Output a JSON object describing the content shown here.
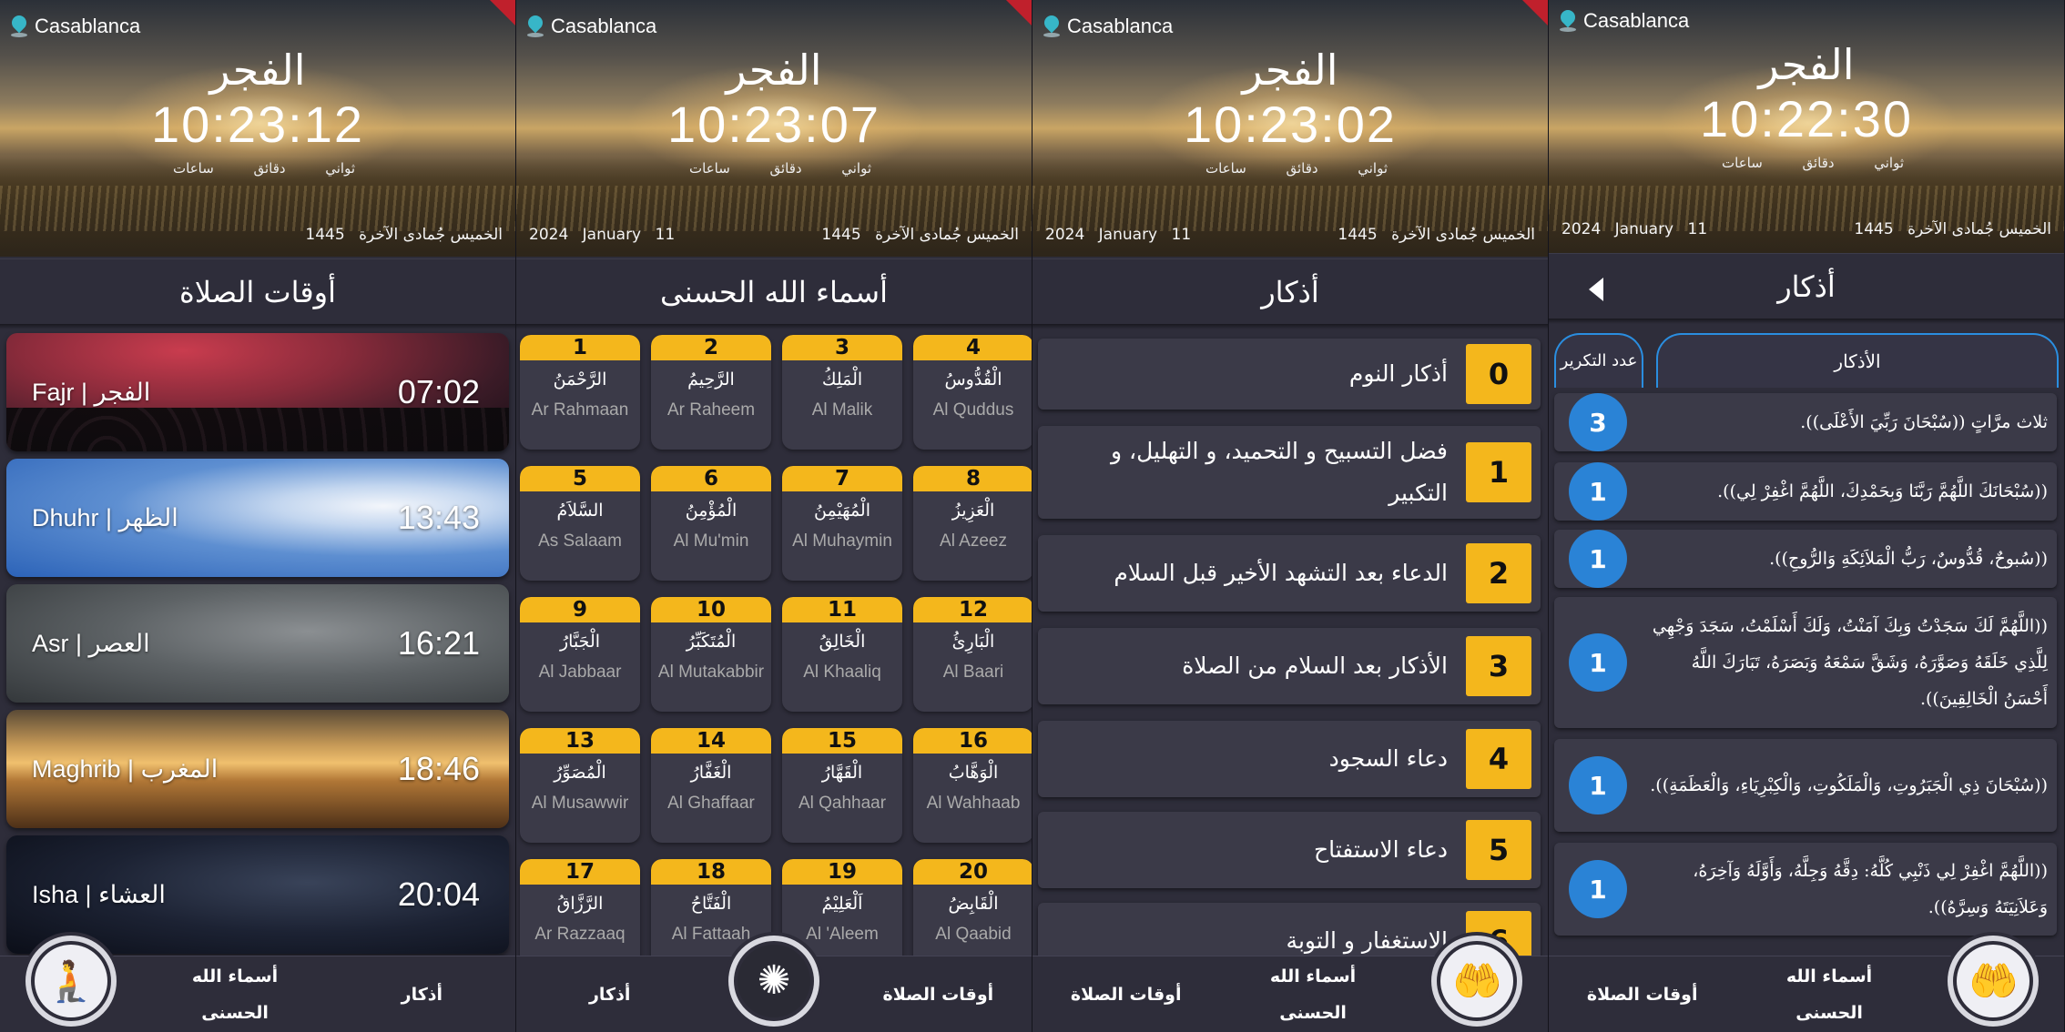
{
  "header": {
    "location": "Casablanca",
    "prayer_name": "الفجر",
    "units": {
      "seconds": "ثواني",
      "minutes": "دقائق",
      "hours": "ساعات"
    },
    "hijri": {
      "weekday": "الخميس",
      "month": "جُمادى الآخرة",
      "year": "1445"
    },
    "gregorian": {
      "day": "11",
      "month": "January",
      "year": "2024"
    },
    "clocks": [
      "10:23:12",
      "10:23:07",
      "10:23:02",
      "10:22:30"
    ]
  },
  "titles": {
    "prayer_times": "أوقات الصلاة",
    "names": "أسماء الله الحسنى",
    "adhkar": "أذكار"
  },
  "prayer_times": [
    {
      "name": "Fajr  |  الفجر",
      "time": "07:02"
    },
    {
      "name": "Dhuhr  |  الظهر",
      "time": "13:43"
    },
    {
      "name": "Asr  |  العصر",
      "time": "16:21"
    },
    {
      "name": "Maghrib  |  المغرب",
      "time": "18:46"
    },
    {
      "name": "Isha  |  العشاء",
      "time": "20:04"
    }
  ],
  "names": [
    {
      "n": "1",
      "ar": "الرَّحْمَنُ",
      "en": "Ar Rahmaan"
    },
    {
      "n": "2",
      "ar": "الرَّحِيمُ",
      "en": "Ar Raheem"
    },
    {
      "n": "3",
      "ar": "الْمَلِكُ",
      "en": "Al Malik"
    },
    {
      "n": "4",
      "ar": "الْقُدُّوسُ",
      "en": "Al Quddus"
    },
    {
      "n": "5",
      "ar": "السَّلاَمُ",
      "en": "As Salaam"
    },
    {
      "n": "6",
      "ar": "الْمُؤْمِنُ",
      "en": "Al Mu'min"
    },
    {
      "n": "7",
      "ar": "الْمُهَيْمِنُ",
      "en": "Al Muhaymin"
    },
    {
      "n": "8",
      "ar": "الْعَزِيزُ",
      "en": "Al Azeez"
    },
    {
      "n": "9",
      "ar": "الْجَبَّارُ",
      "en": "Al Jabbaar"
    },
    {
      "n": "10",
      "ar": "الْمُتَكَبِّرُ",
      "en": "Al Mutakabbir"
    },
    {
      "n": "11",
      "ar": "الْخَالِقُ",
      "en": "Al Khaaliq"
    },
    {
      "n": "12",
      "ar": "الْبَارِئُ",
      "en": "Al Baari"
    },
    {
      "n": "13",
      "ar": "الْمُصَوِّرُ",
      "en": "Al Musawwir"
    },
    {
      "n": "14",
      "ar": "الْغَفَّارُ",
      "en": "Al Ghaffaar"
    },
    {
      "n": "15",
      "ar": "الْقَهَّارُ",
      "en": "Al Qahhaar"
    },
    {
      "n": "16",
      "ar": "الْوَهَّابُ",
      "en": "Al Wahhaab"
    },
    {
      "n": "17",
      "ar": "الرَّزَّاقُ",
      "en": "Ar Razzaaq"
    },
    {
      "n": "18",
      "ar": "الْفَتَّاحُ",
      "en": "Al Fattaah"
    },
    {
      "n": "19",
      "ar": "اَلْعَلِيْمُ",
      "en": "Al 'Aleem"
    },
    {
      "n": "20",
      "ar": "الْقَابِضُ",
      "en": "Al Qaabid"
    }
  ],
  "adhkar_list": [
    {
      "n": "0",
      "text": "أذكار النوم"
    },
    {
      "n": "1",
      "text": "فضل التسبيح و التحميد، و التهليل، و التكبير"
    },
    {
      "n": "2",
      "text": "الدعاء بعد التشهد الأخير قبل السلام"
    },
    {
      "n": "3",
      "text": "الأذكار بعد السلام من الصلاة"
    },
    {
      "n": "4",
      "text": "دعاء السجود"
    },
    {
      "n": "5",
      "text": "دعاء الاستفتاح"
    },
    {
      "n": "6",
      "text": "الاستغفار و التوبة"
    }
  ],
  "detail": {
    "tab_count": "عدد التكرير",
    "tab_main": "الأذكار",
    "items": [
      {
        "count": "3",
        "text": "ثلاث مرَّاتٍ ((سُبْحَانَ رَبِّيَ الأَعْلَى))."
      },
      {
        "count": "1",
        "text": "((سُبْحَانَكَ اللَّهُمَّ رَبَّنَا وَبِحَمْدِكَ، اللَّهُمَّ اغْفِرْ لِي))."
      },
      {
        "count": "1",
        "text": "((سُبوحٌ، قُدُّوسٌ، رَبُّ الْمَلاَئِكَةِ وَالرُّوحِ))."
      },
      {
        "count": "1",
        "text": "((اللَّهُمَّ لَكَ سَجَدْتُ وَبِكَ آمَنْتُ، وَلَكَ أَسْلَمْتُ، سَجَدَ وَجْهِي لِلَّذِي خَلَقَهُ وَصَوَّرَهُ، وَشَقَّ سَمْعَهُ وَبَصَرَهُ، تَبَارَكَ اللَّهُ أَحْسَنُ الْخَالِقِينَ))."
      },
      {
        "count": "1",
        "text": "((سُبْحَانَ ذِي الْجَبَرُوتِ، وَالْمَلَكُوتِ، وَالْكِبْرِيَاءِ، وَالْعَظَمَةِ))."
      },
      {
        "count": "1",
        "text": "((اللَّهُمَّ اغْفِرْ لِي ذَنْبِي كُلَّهُ: دِقَّهُ وَجِلَّهُ، وَأَوَّلَهُ وَآخِرَهُ، وَعَلاَنِيَتَهُ وَسِرَّهُ))."
      }
    ]
  },
  "nav": {
    "prayer_times": "أوقات الصلاة",
    "names": "أسماء الله الحسنى",
    "adhkar": "أذكار"
  },
  "icons": {
    "location": "location-pin-icon",
    "pray": "praying-person-icon",
    "allah": "allah-calligraphy-icon",
    "hands": "dua-hands-icon",
    "back": "back-arrow-icon"
  },
  "colors": {
    "accent_yellow": "#f4b71c",
    "accent_blue": "#2a83d6",
    "panel_bg": "#2e2d3a",
    "card_bg": "#3b3a48",
    "corner_red": "#c0202c"
  }
}
